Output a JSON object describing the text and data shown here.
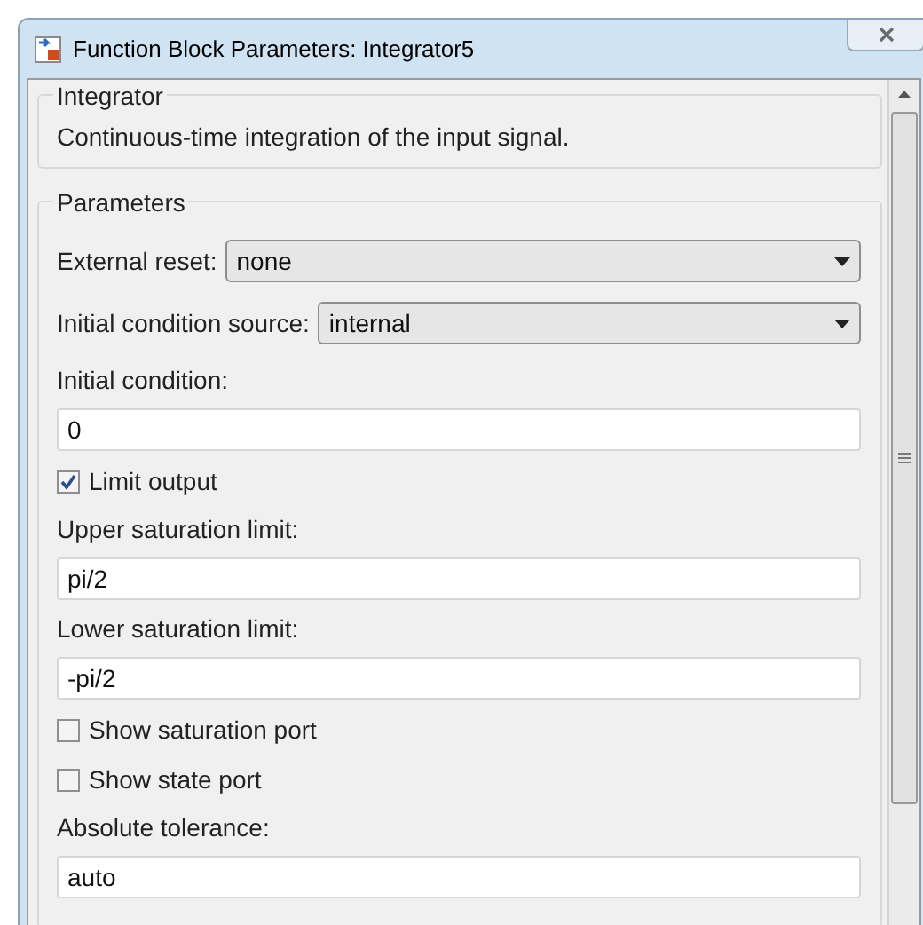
{
  "window": {
    "title": "Function Block Parameters: Integrator5"
  },
  "block": {
    "title": "Integrator",
    "description": "Continuous-time integration of the input signal."
  },
  "parameters": {
    "title": "Parameters",
    "items": [
      {
        "kind": "dropdown",
        "label": "External reset:",
        "value": "none"
      },
      {
        "kind": "dropdown",
        "label": "Initial condition source:",
        "value": "internal"
      },
      {
        "kind": "text",
        "label": "Initial condition:",
        "value": "0"
      },
      {
        "kind": "checkbox",
        "label": "Limit output",
        "checked": true
      },
      {
        "kind": "text",
        "label": "Upper saturation limit:",
        "value": "pi/2"
      },
      {
        "kind": "text",
        "label": "Lower saturation limit:",
        "value": "-pi/2"
      },
      {
        "kind": "checkbox",
        "label": "Show saturation port",
        "checked": false
      },
      {
        "kind": "checkbox",
        "label": "Show state port",
        "checked": false
      },
      {
        "kind": "text",
        "label": "Absolute tolerance:",
        "value": "auto"
      }
    ]
  }
}
